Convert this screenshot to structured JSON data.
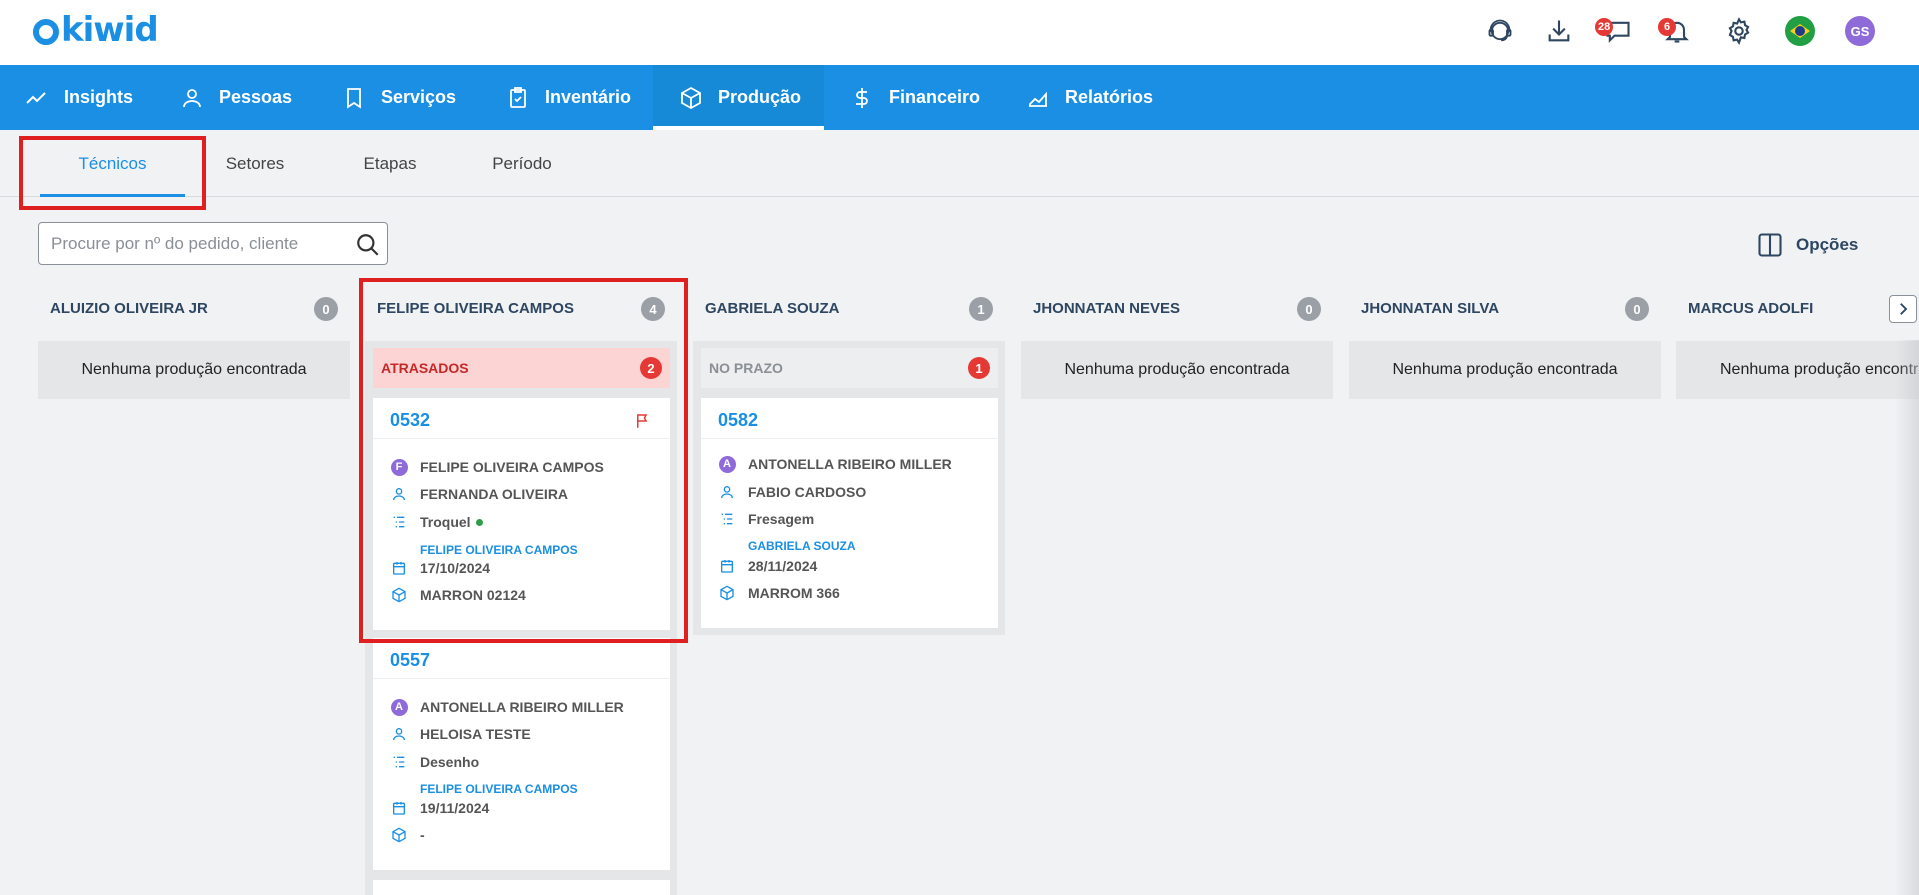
{
  "app": {
    "logo_text": "kiwid"
  },
  "header": {
    "messages_badge": "28",
    "notifications_badge": "6",
    "avatar_initials": "GS"
  },
  "nav": {
    "items": [
      {
        "label": "Insights",
        "icon": "chart-line-icon"
      },
      {
        "label": "Pessoas",
        "icon": "person-icon"
      },
      {
        "label": "Serviços",
        "icon": "bookmark-icon"
      },
      {
        "label": "Inventário",
        "icon": "clipboard-check-icon"
      },
      {
        "label": "Produção",
        "icon": "box-icon",
        "active": true
      },
      {
        "label": "Financeiro",
        "icon": "dollar-icon"
      },
      {
        "label": "Relatórios",
        "icon": "area-chart-icon"
      }
    ]
  },
  "subtabs": {
    "items": [
      {
        "label": "Técnicos",
        "active": true
      },
      {
        "label": "Setores"
      },
      {
        "label": "Etapas"
      },
      {
        "label": "Período"
      }
    ]
  },
  "search": {
    "placeholder": "Procure por nº do pedido, cliente",
    "value": ""
  },
  "options_label": "Opções",
  "empty_text": "Nenhuma produção encontrada",
  "columns": [
    {
      "name": "ALUIZIO OLIVEIRA JR",
      "count": "0"
    },
    {
      "name": "FELIPE OLIVEIRA CAMPOS",
      "count": "4",
      "group": {
        "label": "ATRASADOS",
        "count": "2"
      },
      "cards": [
        {
          "number": "0532",
          "patient_initial": "F",
          "patient": "FELIPE OLIVEIRA CAMPOS",
          "client": "FERNANDA OLIVEIRA",
          "step": "Troquel",
          "technician": "FELIPE OLIVEIRA CAMPOS",
          "date": "17/10/2024",
          "material": "MARRON 02124"
        },
        {
          "number": "0557",
          "patient_initial": "A",
          "patient": "ANTONELLA RIBEIRO MILLER",
          "client": "HELOISA TESTE",
          "step": "Desenho",
          "technician": "FELIPE OLIVEIRA CAMPOS",
          "date": "19/11/2024",
          "material": "-"
        }
      ]
    },
    {
      "name": "GABRIELA SOUZA",
      "count": "1",
      "group": {
        "label": "NO PRAZO",
        "count": "1"
      },
      "cards": [
        {
          "number": "0582",
          "patient_initial": "A",
          "patient": "ANTONELLA RIBEIRO MILLER",
          "client": "FABIO CARDOSO",
          "step": "Fresagem",
          "technician": "GABRIELA SOUZA",
          "date": "28/11/2024",
          "material": "MARROM 366"
        }
      ]
    },
    {
      "name": "JHONNATAN NEVES",
      "count": "0"
    },
    {
      "name": "JHONNATAN SILVA",
      "count": "0"
    },
    {
      "name": "MARCUS ADOLFI"
    }
  ],
  "colors": {
    "primary": "#1a8fe3",
    "danger": "#e53935",
    "heading": "#2e4660"
  }
}
